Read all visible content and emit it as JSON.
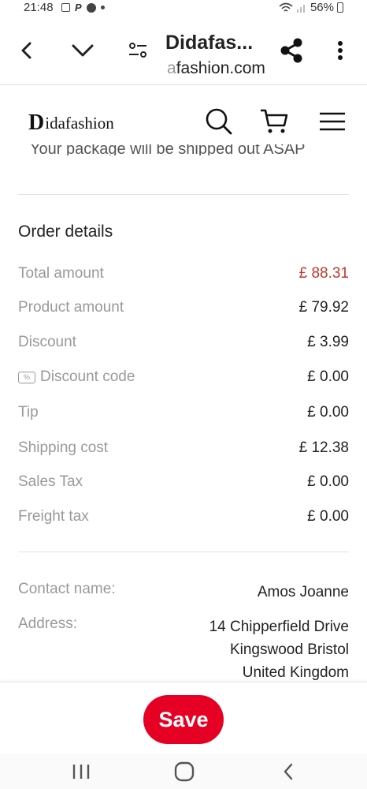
{
  "status_bar": {
    "time": "21:48",
    "battery": "56%"
  },
  "browser": {
    "title": "Didafas...",
    "url_prefix": "a",
    "url_rest": "fashion.com",
    "icons": [
      "back-icon",
      "chevron-down-icon",
      "page-settings-icon",
      "share-icon",
      "more-icon"
    ]
  },
  "site": {
    "logo_mark": "D",
    "logo_text": "idafashion",
    "clipped_text": "Your package will be shipped out ASAP"
  },
  "order": {
    "title": "Order details",
    "rows": [
      {
        "label": "Total amount",
        "value": "£ 88.31",
        "accent": "#c0392b"
      },
      {
        "label": "Product amount",
        "value": "£ 79.92"
      },
      {
        "label": "Discount",
        "value": "£ 3.99"
      },
      {
        "label": "Discount code",
        "value": "£ 0.00",
        "icon": "coupon-icon",
        "icon_glyph": "%"
      },
      {
        "label": "Tip",
        "value": "£ 0.00"
      },
      {
        "label": "Shipping cost",
        "value": "£ 12.38"
      },
      {
        "label": "Sales Tax",
        "value": "£ 0.00"
      },
      {
        "label": "Freight tax",
        "value": "£ 0.00"
      }
    ]
  },
  "contact": {
    "name_label": "Contact name:",
    "name_value": "Amos Joanne",
    "address_label": "Address:",
    "address_lines": [
      "14 Chipperfield Drive",
      "Kingswood Bristol",
      "United Kingdom"
    ]
  },
  "save_button": {
    "label": "Save",
    "color": "#e60023"
  }
}
